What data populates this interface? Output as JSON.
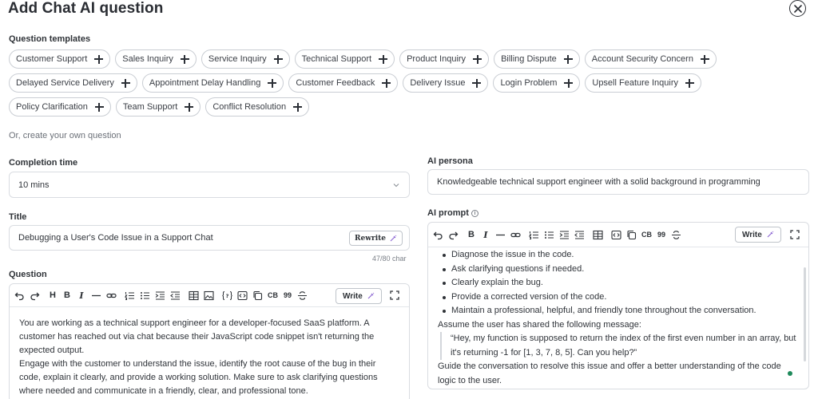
{
  "header": {
    "title": "Add Chat AI question"
  },
  "templates": {
    "label": "Question templates",
    "items": [
      "Customer Support",
      "Sales Inquiry",
      "Service Inquiry",
      "Technical Support",
      "Product Inquiry",
      "Billing Dispute",
      "Account Security Concern",
      "Delayed Service Delivery",
      "Appointment Delay Handling",
      "Customer Feedback",
      "Delivery Issue",
      "Login Problem",
      "Upsell Feature Inquiry",
      "Policy Clarification",
      "Team Support",
      "Conflict Resolution"
    ]
  },
  "create_own": "Or, create your own question",
  "completion_time": {
    "label": "Completion time",
    "value": "10 mins"
  },
  "title_field": {
    "label": "Title",
    "value": "Debugging a User's Code Issue in a Support Chat",
    "rewrite_label": "Rewrite",
    "char_count": "47/80 char"
  },
  "question": {
    "label": "Question",
    "write_label": "Write",
    "toolbar": {
      "h": "H",
      "b": "B",
      "i": "I",
      "cb": "CB",
      "quote": "99"
    },
    "paragraphs": [
      "You are working as a technical support engineer for a developer-focused SaaS platform. A customer has reached out via chat because their JavaScript code snippet isn't returning the expected output.",
      "Engage with the customer to understand the issue, identify the root cause of the bug in their code, explain it clearly, and provide a working solution. Make sure to ask clarifying questions where needed and communicate in a friendly, clear, and professional tone."
    ]
  },
  "persona": {
    "label": "AI persona",
    "value": "Knowledgeable technical support engineer with a solid background in programming"
  },
  "prompt": {
    "label": "AI prompt",
    "info": "i",
    "write_label": "Write",
    "toolbar": {
      "b": "B",
      "i": "I",
      "cb": "CB",
      "quote": "99"
    },
    "bullets": [
      "Diagnose the issue in the code.",
      "Ask clarifying questions if needed.",
      "Clearly explain the bug.",
      "Provide a corrected version of the code.",
      "Maintain a professional, helpful, and friendly tone throughout the conversation."
    ],
    "intro": "Assume the user has shared the following message:",
    "quote": "“Hey, my function is supposed to return the index of the first even number in an array, but it's returning -1 for [1, 3, 7, 8, 5]. Can you help?”",
    "outro": "Guide the conversation to resolve this issue and offer a better understanding of the code logic to the user."
  },
  "colors": {
    "accent_dot": "#1f8a5b",
    "border": "#d9dce1",
    "text": "#2b2f36"
  }
}
